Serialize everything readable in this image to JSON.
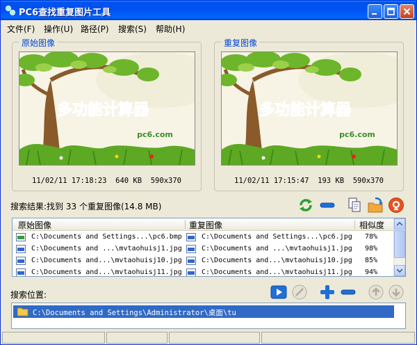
{
  "window": {
    "title": "PC6查找重复图片工具"
  },
  "menu": [
    {
      "label": "文件(F)"
    },
    {
      "label": "操作(U)"
    },
    {
      "label": "路径(P)"
    },
    {
      "label": "搜索(S)"
    },
    {
      "label": "帮助(H)"
    }
  ],
  "original": {
    "panel_title": "原始图像",
    "image_caption": "多功能计算器",
    "brand": "pc6.com",
    "date": "11/02/11",
    "time": "17:18:23",
    "size": "640 KB",
    "dimensions": "590x370"
  },
  "duplicate": {
    "panel_title": "重复图像",
    "image_caption": "多功能计算器",
    "brand": "pc6.com",
    "date": "11/02/11",
    "time": "17:15:47",
    "size": "193 KB",
    "dimensions": "590x370"
  },
  "results": {
    "summary": "搜索结果:找到 33 个重复图像(14.8 MB)",
    "columns": [
      "原始图像",
      "重复图像",
      "相似度"
    ],
    "rows": [
      {
        "orig_icon": "BMP",
        "original": "C:\\Documents and Settings...\\pc6.bmp",
        "dup_icon": "JPG",
        "duplicate": "C:\\Documents and Settings...\\pc6.jpg",
        "similarity": "78%"
      },
      {
        "orig_icon": "JPG",
        "original": "C:\\Documents and ...\\mvtaohuisj1.jpg",
        "dup_icon": "JPG",
        "duplicate": "C:\\Documents and ...\\mvtaohuisj1.jpg",
        "similarity": "98%"
      },
      {
        "orig_icon": "JPG",
        "original": "C:\\Documents and...\\mvtaohuisj10.jpg",
        "dup_icon": "JPG",
        "duplicate": "C:\\Documents and...\\mvtaohuisj10.jpg",
        "similarity": "85%"
      },
      {
        "orig_icon": "JPG",
        "original": "C:\\Documents and...\\mvtaohuisj11.jpg",
        "dup_icon": "JPG",
        "duplicate": "C:\\Documents and...\\mvtaohuisj11.jpg",
        "similarity": "94%"
      }
    ]
  },
  "search_location": {
    "label": "搜索位置:",
    "paths": [
      "C:\\Documents and Settings\\Administrator\\桌面\\tu"
    ]
  },
  "colors": {
    "accent": "#316AC5",
    "title_blue": "#0046D5",
    "window_bg": "#ECE9D8"
  },
  "icons": [
    "refresh-icon",
    "remove-icon",
    "copy-icon",
    "move-icon",
    "delete-icon",
    "play-icon",
    "stop-icon",
    "add-icon",
    "minus-icon",
    "up-icon",
    "down-icon",
    "folder-icon"
  ]
}
